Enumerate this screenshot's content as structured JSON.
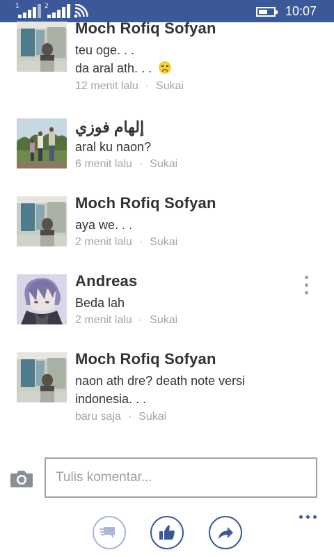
{
  "status_bar": {
    "sim1_label": "1",
    "sim2_label": "2",
    "time": "10:07",
    "battery_level": 0.6,
    "bar_color": "#3b5998"
  },
  "comments": [
    {
      "name": "Moch Rofiq Sofyan",
      "lines": [
        "teu oge. . .",
        "da aral ath. . ."
      ],
      "emoji": "frowning-face",
      "time": "12 menit lalu",
      "separator": "·",
      "like_label": "Sukai"
    },
    {
      "name": "إلهام فوزي",
      "lines": [
        "aral ku naon?"
      ],
      "time": "6 menit lalu",
      "separator": "·",
      "like_label": "Sukai"
    },
    {
      "name": "Moch Rofiq Sofyan",
      "lines": [
        "aya we. . ."
      ],
      "time": "2 menit lalu",
      "separator": "·",
      "like_label": "Sukai"
    },
    {
      "name": "Andreas",
      "lines": [
        "Beda lah"
      ],
      "time": "2 menit lalu",
      "separator": "·",
      "like_label": "Sukai"
    },
    {
      "name": "Moch Rofiq Sofyan",
      "lines": [
        "naon ath dre? death note versi",
        "indonesia. . ."
      ],
      "time": "baru saja",
      "separator": "·",
      "like_label": "Sukai"
    }
  ],
  "composer": {
    "placeholder": "Tulis komentar...",
    "value": ""
  },
  "app_bar": {
    "buttons": [
      "comments-icon",
      "like-icon",
      "share-icon"
    ],
    "more": "more-options-icon",
    "accent": "#3b5998"
  }
}
